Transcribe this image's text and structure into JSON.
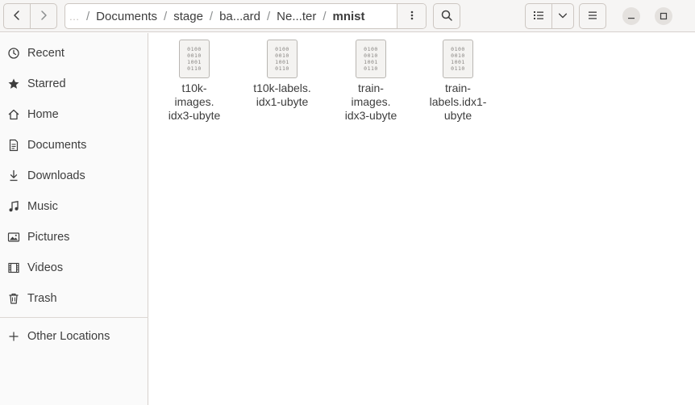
{
  "toolbar": {
    "back_icon": "chevron-left-icon",
    "forward_icon": "chevron-right-icon",
    "search_icon": "search-icon",
    "view_icon": "list-view-icon",
    "view_dropdown_icon": "chevron-down-icon",
    "menu_icon": "hamburger-icon"
  },
  "pathbar": {
    "overflow_glyph": "…",
    "items": [
      "Documents",
      "stage",
      "ba...ard",
      "Ne...ter"
    ],
    "current": "mnist",
    "separator": "/"
  },
  "window": {
    "minimize_icon": "minimize-icon",
    "maximize_icon": "maximize-icon",
    "close_icon": "close-icon"
  },
  "sidebar": {
    "items": [
      {
        "label": "Recent",
        "icon": "clock-icon"
      },
      {
        "label": "Starred",
        "icon": "star-icon"
      },
      {
        "label": "Home",
        "icon": "home-icon"
      },
      {
        "label": "Documents",
        "icon": "document-icon"
      },
      {
        "label": "Downloads",
        "icon": "download-icon"
      },
      {
        "label": "Music",
        "icon": "music-icon"
      },
      {
        "label": "Pictures",
        "icon": "picture-icon"
      },
      {
        "label": "Videos",
        "icon": "video-icon"
      },
      {
        "label": "Trash",
        "icon": "trash-icon"
      }
    ],
    "other_locations": {
      "label": "Other Locations",
      "icon": "plus-icon"
    }
  },
  "files": [
    {
      "name_lines": [
        "t10k-",
        "images.",
        "idx3-ubyte"
      ],
      "icon": "binary-file-icon"
    },
    {
      "name_lines": [
        "t10k-labels.",
        "idx1-ubyte"
      ],
      "icon": "binary-file-icon"
    },
    {
      "name_lines": [
        "train-",
        "images.",
        "idx3-ubyte"
      ],
      "icon": "binary-file-icon"
    },
    {
      "name_lines": [
        "train-",
        "labels.idx1-",
        "ubyte"
      ],
      "icon": "binary-file-icon"
    }
  ],
  "binary_glyph_lines": [
    "0100",
    "0010",
    "1001",
    "0110"
  ],
  "colors": {
    "headerbar": "#f6f5f4",
    "sidebar": "#fafafa",
    "text": "#3d3d3d",
    "border": "#cdc7c2"
  }
}
